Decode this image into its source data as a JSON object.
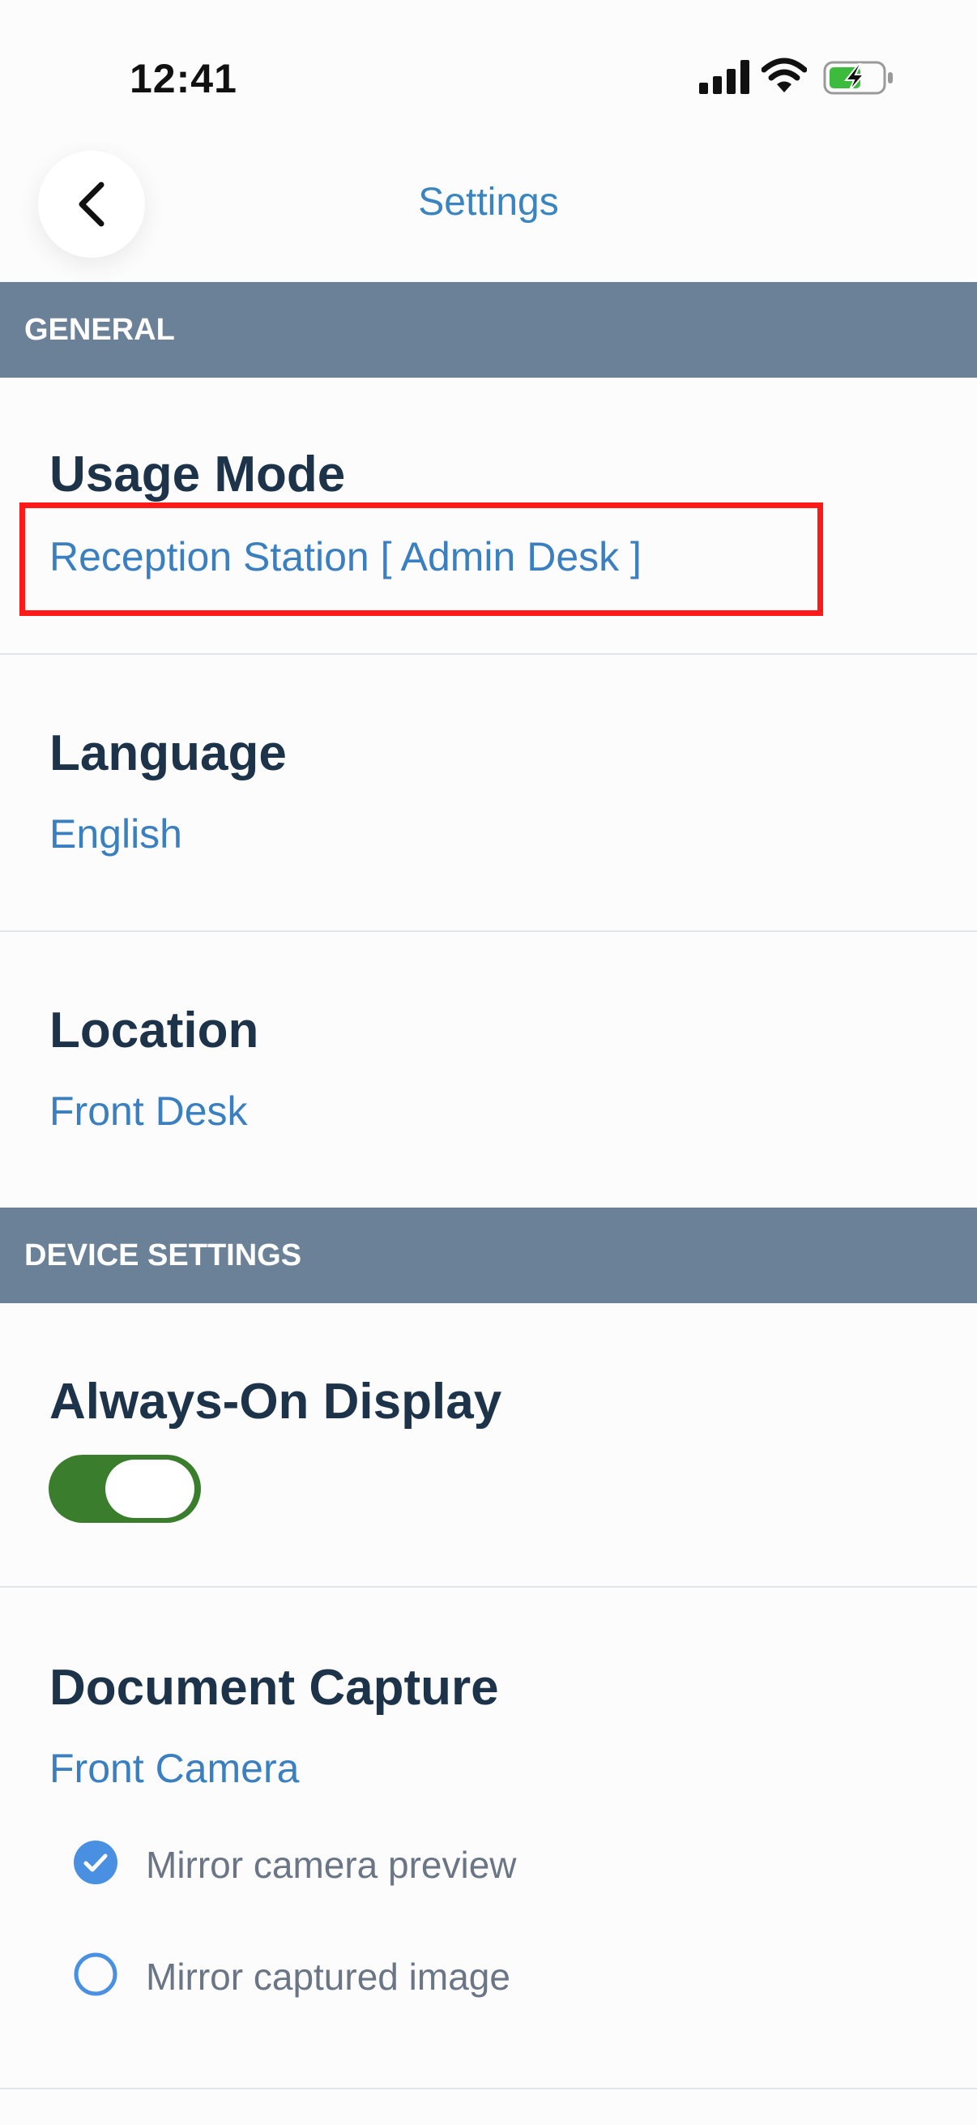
{
  "status_bar": {
    "time": "12:41",
    "icons": [
      "signal-icon",
      "wifi-icon",
      "battery-charging-icon"
    ]
  },
  "nav": {
    "title": "Settings",
    "back_icon": "chevron-left-icon"
  },
  "sections": {
    "general": {
      "label": "GENERAL"
    },
    "device": {
      "label": "DEVICE SETTINGS"
    }
  },
  "settings": {
    "usage_mode": {
      "title": "Usage Mode",
      "value": "Reception Station [ Admin Desk ]"
    },
    "language": {
      "title": "Language",
      "value": "English"
    },
    "location": {
      "title": "Location",
      "value": "Front Desk"
    },
    "always_on_display": {
      "title": "Always-On Display",
      "enabled": true
    },
    "document_capture": {
      "title": "Document Capture",
      "value": "Front Camera",
      "options": [
        {
          "label": "Mirror camera preview",
          "checked": true
        },
        {
          "label": "Mirror captured image",
          "checked": false
        }
      ]
    }
  },
  "colors": {
    "accent": "#3a85c0",
    "section_header_bg": "#6b8197",
    "toggle_on": "#3a7d2c",
    "highlight": "#ff1a1a",
    "battery_charging": "#3dbb3d"
  }
}
